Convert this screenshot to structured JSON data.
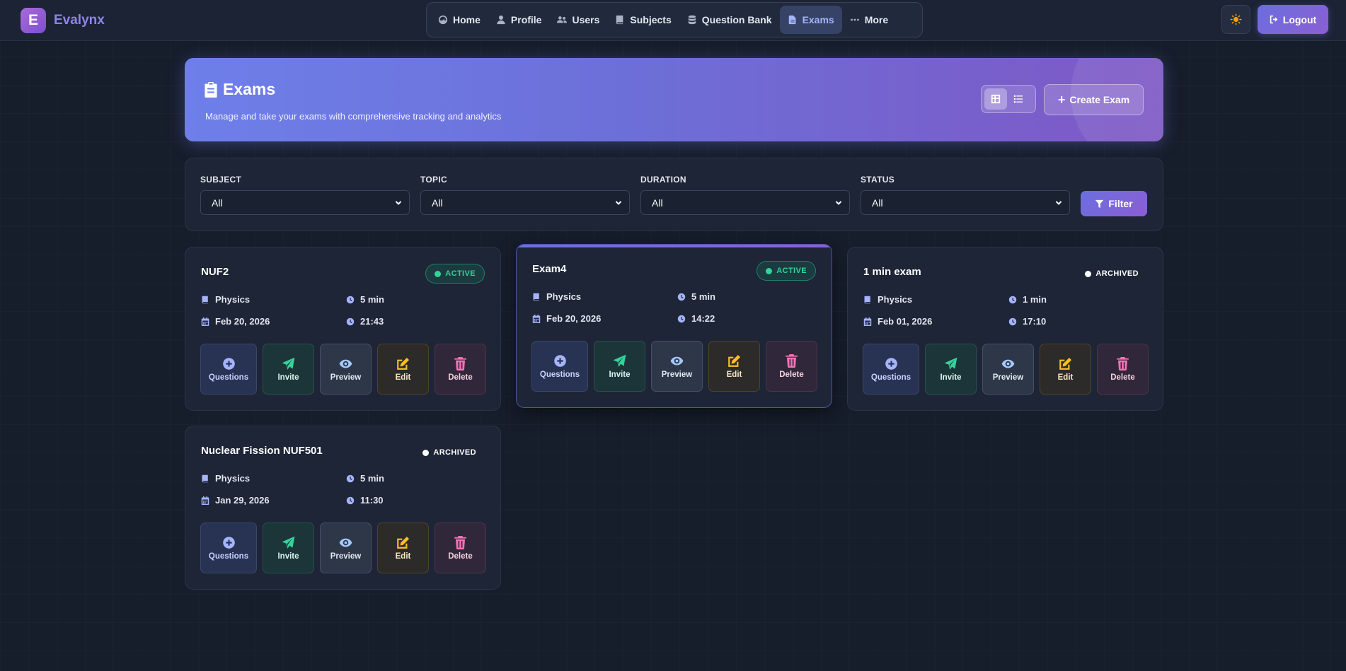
{
  "app": {
    "name": "Evalynx",
    "logo_letter": "E"
  },
  "nav": {
    "items": [
      {
        "label": "Home",
        "icon": "gauge-icon"
      },
      {
        "label": "Profile",
        "icon": "user-icon"
      },
      {
        "label": "Users",
        "icon": "users-icon"
      },
      {
        "label": "Subjects",
        "icon": "book-icon"
      },
      {
        "label": "Question Bank",
        "icon": "database-icon"
      },
      {
        "label": "Exams",
        "icon": "file-icon",
        "active": true
      },
      {
        "label": "More",
        "icon": "ellipsis-icon"
      }
    ]
  },
  "header": {
    "theme_icon": "sun-icon",
    "logout_label": "Logout"
  },
  "hero": {
    "title": "Exams",
    "subtitle": "Manage and take your exams with comprehensive tracking and analytics",
    "create_label": "Create Exam",
    "view_mode": "grid"
  },
  "filters": {
    "subject": {
      "label": "SUBJECT",
      "value": "All"
    },
    "topic": {
      "label": "TOPIC",
      "value": "All"
    },
    "duration": {
      "label": "DURATION",
      "value": "All"
    },
    "status": {
      "label": "STATUS",
      "value": "All"
    },
    "button_label": "Filter"
  },
  "actions": {
    "questions": "Questions",
    "invite": "Invite",
    "preview": "Preview",
    "edit": "Edit",
    "delete": "Delete"
  },
  "exams": [
    {
      "title": "NUF2",
      "status": "ACTIVE",
      "subject": "Physics",
      "duration": "5 min",
      "date": "Feb 20, 2026",
      "time": "21:43"
    },
    {
      "title": "Exam4",
      "status": "ACTIVE",
      "subject": "Physics",
      "duration": "5 min",
      "date": "Feb 20, 2026",
      "time": "14:22"
    },
    {
      "title": "1 min exam",
      "status": "ARCHIVED",
      "subject": "Physics",
      "duration": "1 min",
      "date": "Feb 01, 2026",
      "time": "17:10"
    },
    {
      "title": "Nuclear Fission NUF501",
      "status": "ARCHIVED",
      "subject": "Physics",
      "duration": "5 min",
      "date": "Jan 29, 2026",
      "time": "11:30"
    }
  ],
  "colors": {
    "accent": "#6c6ee0",
    "active": "#34d399",
    "background": "#161d2b"
  }
}
